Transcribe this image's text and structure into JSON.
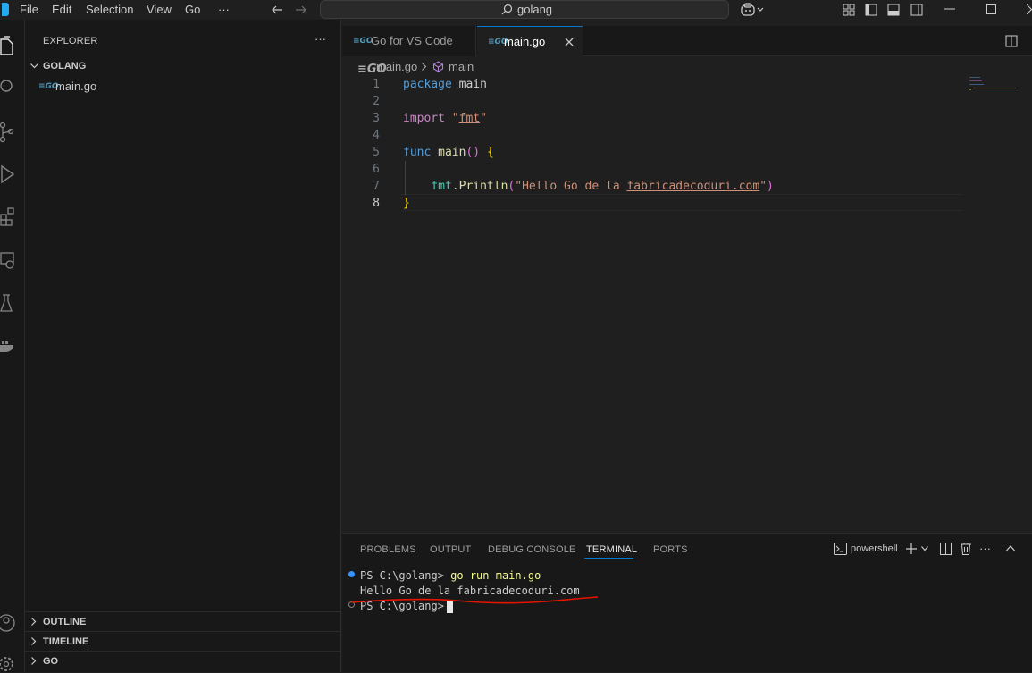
{
  "menu": {
    "items": [
      "File",
      "Edit",
      "Selection",
      "View",
      "Go",
      "···"
    ]
  },
  "search": {
    "label": "golang"
  },
  "sidebar": {
    "title": "EXPLORER",
    "more": "···",
    "folder": "GOLANG",
    "file": "main.go",
    "sections": [
      "OUTLINE",
      "TIMELINE",
      "GO"
    ]
  },
  "tabs": [
    {
      "label": "Go for VS Code",
      "active": false
    },
    {
      "label": "main.go",
      "active": true
    }
  ],
  "breadcrumb": {
    "file": "main.go",
    "symbol": "main"
  },
  "editor": {
    "line_numbers": [
      "1",
      "2",
      "3",
      "4",
      "5",
      "6",
      "7",
      "8"
    ],
    "active_line": 8,
    "code": {
      "l1_kw": "package",
      "l1_name": "main",
      "l3_kw": "import",
      "l3_str_open": "\"",
      "l3_str_mid": "fmt",
      "l3_str_close": "\"",
      "l5_kw": "func",
      "l5_fn": "main",
      "l5_paren": "()",
      "l5_brace": "{",
      "l7_pkg": "fmt",
      "l7_dot": ".",
      "l7_fn": "Println",
      "l7_po": "(",
      "l7_str_a": "\"Hello Go de la ",
      "l7_str_b": "fabricadecoduri.com",
      "l7_str_c": "\"",
      "l7_pc": ")",
      "l8_brace": "}"
    }
  },
  "panel": {
    "tabs": [
      "PROBLEMS",
      "OUTPUT",
      "DEBUG CONSOLE",
      "TERMINAL",
      "PORTS"
    ],
    "active_tab": "TERMINAL",
    "shell": "powershell"
  },
  "terminal": {
    "line1_prompt": "PS C:\\golang> ",
    "line1_cmd": "go run main.go",
    "line2": "Hello Go de la fabricadecoduri.com",
    "line3_prompt": "PS C:\\golang> "
  },
  "colors": {
    "accent": "#0078d4",
    "annotation": "#e51400"
  }
}
